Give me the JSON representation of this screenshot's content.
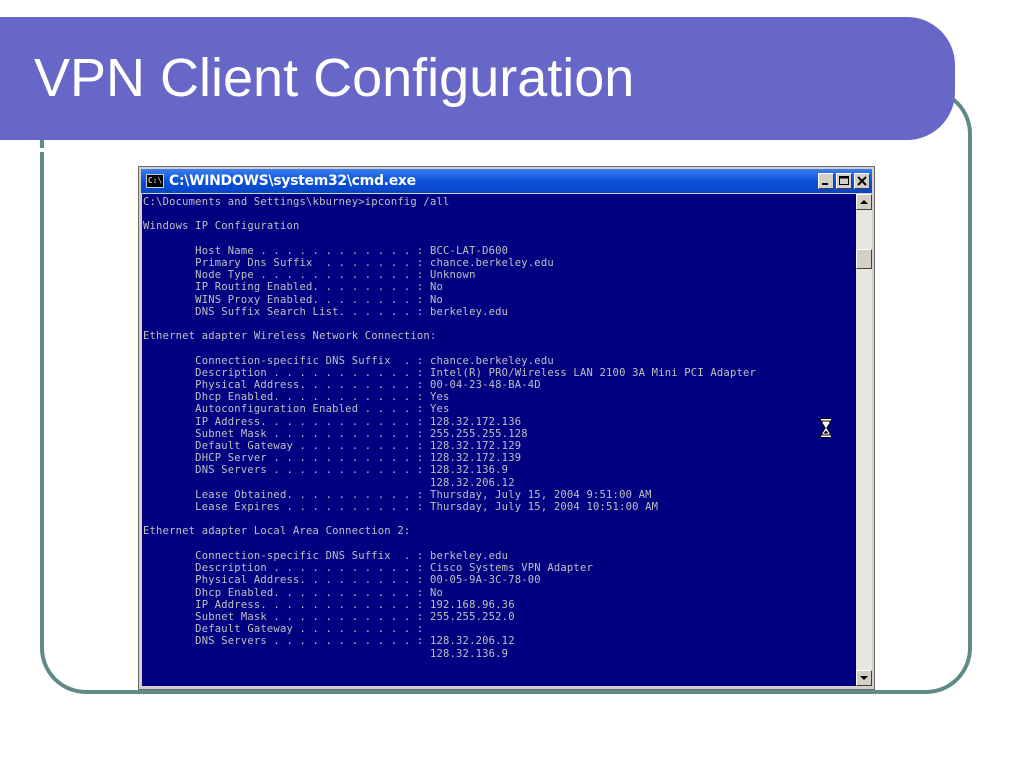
{
  "slide": {
    "title": "VPN Client Configuration"
  },
  "window": {
    "title": "C:\\WINDOWS\\system32\\cmd.exe",
    "icon_text": "C:\\"
  },
  "console": {
    "text": "C:\\Documents and Settings\\kburney>ipconfig /all\n\nWindows IP Configuration\n\n        Host Name . . . . . . . . . . . . : BCC-LAT-D600\n        Primary Dns Suffix  . . . . . . . : chance.berkeley.edu\n        Node Type . . . . . . . . . . . . : Unknown\n        IP Routing Enabled. . . . . . . . : No\n        WINS Proxy Enabled. . . . . . . . : No\n        DNS Suffix Search List. . . . . . : berkeley.edu\n\nEthernet adapter Wireless Network Connection:\n\n        Connection-specific DNS Suffix  . : chance.berkeley.edu\n        Description . . . . . . . . . . . : Intel(R) PRO/Wireless LAN 2100 3A Mini PCI Adapter\n        Physical Address. . . . . . . . . : 00-04-23-48-BA-4D\n        Dhcp Enabled. . . . . . . . . . . : Yes\n        Autoconfiguration Enabled . . . . : Yes\n        IP Address. . . . . . . . . . . . : 128.32.172.136\n        Subnet Mask . . . . . . . . . . . : 255.255.255.128\n        Default Gateway . . . . . . . . . : 128.32.172.129\n        DHCP Server . . . . . . . . . . . : 128.32.172.139\n        DNS Servers . . . . . . . . . . . : 128.32.136.9\n                                            128.32.206.12\n        Lease Obtained. . . . . . . . . . : Thursday, July 15, 2004 9:51:00 AM\n        Lease Expires . . . . . . . . . . : Thursday, July 15, 2004 10:51:00 AM\n\nEthernet adapter Local Area Connection 2:\n\n        Connection-specific DNS Suffix  . : berkeley.edu\n        Description . . . . . . . . . . . : Cisco Systems VPN Adapter\n        Physical Address. . . . . . . . . : 00-05-9A-3C-78-00\n        Dhcp Enabled. . . . . . . . . . . : No\n        IP Address. . . . . . . . . . . . : 192.168.96.36\n        Subnet Mask . . . . . . . . . . . : 255.255.252.0\n        Default Gateway . . . . . . . . . :\n        DNS Servers . . . . . . . . . . . : 128.32.206.12\n                                            128.32.136.9"
  },
  "icons": {
    "window": "cmd-icon",
    "cursor": "hourglass-icon",
    "minimize": "minimize-icon",
    "maximize": "maximize-icon",
    "close": "close-icon"
  },
  "colors": {
    "title_bar": "#6767c8",
    "frame": "#5f8a87",
    "console_bg": "#000080",
    "console_fg": "#c0c0c0"
  }
}
